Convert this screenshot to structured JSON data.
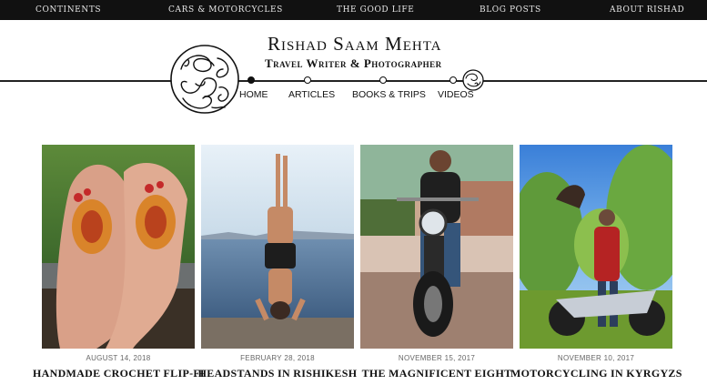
{
  "topnav": [
    "CONTINENTS",
    "CARS & MOTORCYCLES",
    "THE GOOD LIFE",
    "BLOG POSTS",
    "ABOUT RISHAD"
  ],
  "header": {
    "title": "Rishad Saam Mehta",
    "tagline": "Travel Writer & Photographer"
  },
  "mainnav": [
    "HOME",
    "ARTICLES",
    "BOOKS & TRIPS",
    "VIDEOS"
  ],
  "active_nav": "HOME",
  "posts": [
    {
      "date": "AUGUST 14, 2018",
      "title": "HANDMADE CROCHET FLIP-FLOPS"
    },
    {
      "date": "FEBRUARY 28, 2018",
      "title": "HEADSTANDS IN RISHIKESH"
    },
    {
      "date": "NOVEMBER 15, 2017",
      "title": "THE MAGNIFICENT EIGHT"
    },
    {
      "date": "NOVEMBER 10, 2017",
      "title": "MOTORCYCLING IN KYRGYZSTAN"
    }
  ],
  "colors": {
    "topbar": "#111111",
    "text": "#111111",
    "date": "#666666"
  }
}
